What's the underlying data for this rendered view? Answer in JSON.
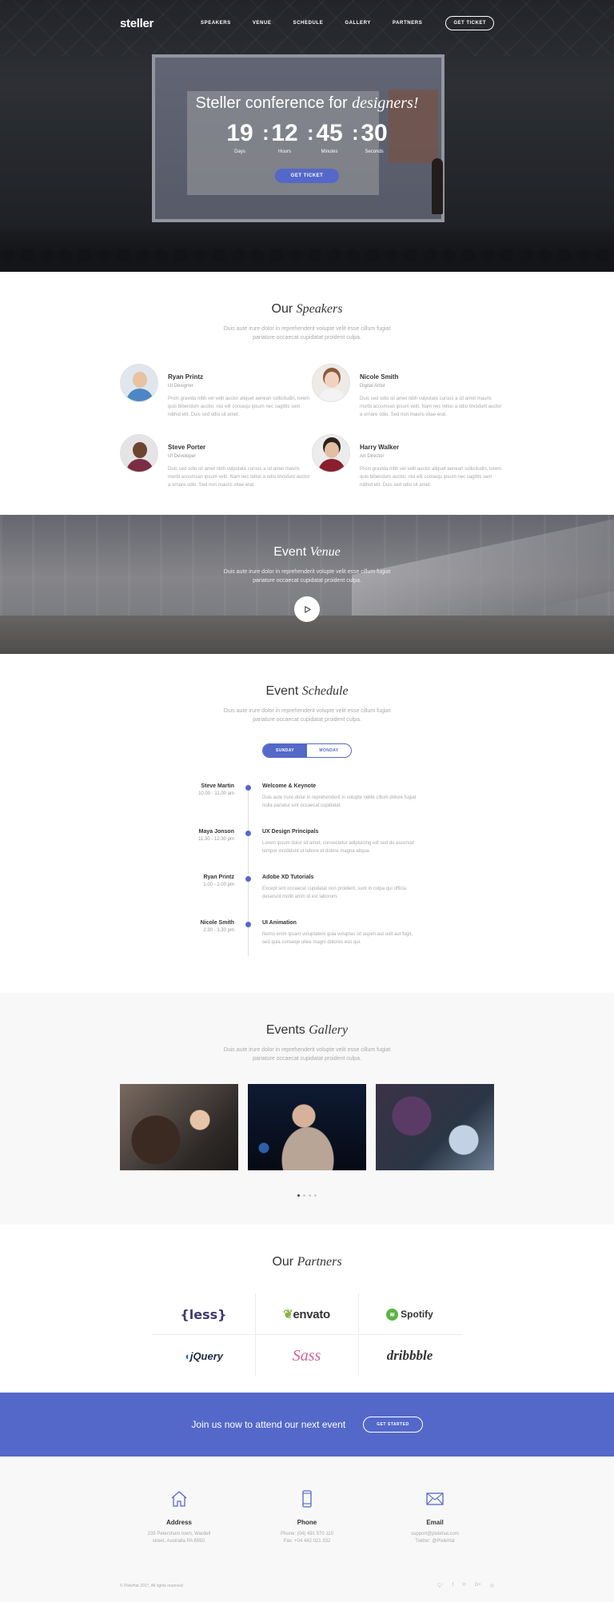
{
  "nav": {
    "logo": "steller",
    "links": [
      "SPEAKERS",
      "VENUE",
      "SCHEDULE",
      "GALLERY",
      "PARTNERS"
    ],
    "ticket": "GET TICKET"
  },
  "hero": {
    "title_plain": "Steller conference for ",
    "title_em": "designers!",
    "countdown": [
      {
        "value": "19",
        "label": "Days"
      },
      {
        "value": "12",
        "label": "Hours"
      },
      {
        "value": "45",
        "label": "Minutes"
      },
      {
        "value": "30",
        "label": "Seconds"
      }
    ],
    "button": "GET TICKET"
  },
  "speakers": {
    "title_plain": "Our ",
    "title_em": "Speakers",
    "desc1": "Duis aute irure dolor in reprehenderit volupte velit esse cillum fugiat",
    "desc2": "pariature occaecat cupidatat proident culpa.",
    "items": [
      {
        "name": "Ryan Printz",
        "role": "UI Designer",
        "bio": "Proin gravida nibh vel velit auctor aliquet aenean sollicitudin, lorem quis bibendum auctor, nisi elit consequ ipsum nec sagittis sem nibhid elit. Duis sed odio sit amet."
      },
      {
        "name": "Nicole Smith",
        "role": "Digital Artist",
        "bio": "Duis sed odio sit amet nibh vulputate cursus a sit amet mauris morbi accumsan ipsum velit. Nam nec tellus a odio tincidunt auctor a ornare odio. Sed non mauris vitae erat."
      },
      {
        "name": "Steve Porter",
        "role": "UI Developer",
        "bio": "Duis sed odio sit amet nibh vulputate cursus a sit amet mauris morbi accumsan ipsum velit. Nam nec tellus a odio tincidunt auctor a ornare odio. Sed non mauris vitae erat."
      },
      {
        "name": "Harry Walker",
        "role": "Art Director",
        "bio": "Proin gravida nibh vel velit auctor aliquet aenean sollicitudin, lorem quis bibendum auctor, nisi elit consequ ipsum nec sagittis sem nibhid elit. Duis sed odio sit amet."
      }
    ]
  },
  "venue": {
    "title_plain": "Event ",
    "title_em": "Venue",
    "desc1": "Duis aute irure dolor in reprehenderit volupte velit esse cillum fugiat",
    "desc2": "pariature occaecat cupidatat proident culpa."
  },
  "schedule": {
    "title_plain": "Event ",
    "title_em": "Schedule",
    "desc1": "Duis aute irure dolor in reprehenderit volupte velit esse cillum fugiat",
    "desc2": "pariature occaecat cupidatat proident culpa.",
    "tabs": [
      "SUNDAY",
      "MONDAY"
    ],
    "items": [
      {
        "who": "Steve Martin",
        "time": "10.00 - 11.00 am",
        "title": "Welcome & Keynote",
        "text": "Duis aute irure dolor in reprehenderit in volupte velite cillum dolore fugiat nulla pariatur sint occaecat cupidatat."
      },
      {
        "who": "Maya Jonson",
        "time": "11.30 - 12.30 pm",
        "title": "UX Design Principals",
        "text": "Lorem ipsum dolor sit amet, consectetur adipisicing elit sed do eiusmod tempor incididunt ut labore et dolore magna aliqua."
      },
      {
        "who": "Ryan Printz",
        "time": "1.00 - 2.00 pm",
        "title": "Adobe XD Tutorials",
        "text": "Except sint occaecat cupidatat non proident, sunt in culpa qui officia deserunt mollit anim id est laborum."
      },
      {
        "who": "Nicole Smith",
        "time": "2.30 - 3.30 pm",
        "title": "UI Animation",
        "text": "Nemo enim ipsam voluptatem quia voluptas sit aspen aut odit aut fugit, sed quia conseqe uitee magni dolores eos qui."
      }
    ]
  },
  "gallery": {
    "title_plain": "Events ",
    "title_em": "Gallery",
    "desc1": "Duis aute irure dolor in reprehenderit volupte velit esse cillum fugiat",
    "desc2": "pariature occaecat cupidatat proident culpa."
  },
  "partners": {
    "title_plain": "Our ",
    "title_em": "Partners",
    "logos": [
      "{less}",
      "envato",
      "Spotify",
      "jQuery",
      "Sass",
      "dribbble"
    ]
  },
  "cta": {
    "text": "Join us now to attend our next event",
    "button": "GET STARTED"
  },
  "footer": {
    "address_title": "Address",
    "address_line1": "235 Petersham town, Wardell",
    "address_line2": "street, Australia PA 6550.",
    "phone_title": "Phone",
    "phone_line1": "Phone: (04) 491 570 110",
    "phone_line2": "Fax: +04 442 021 332",
    "email_title": "Email",
    "email_line1": "support@pixlehat.com",
    "email_line2": "Twitter: @PixleHat",
    "copyright": "© PixleHat 2017, All rights reserved",
    "social": [
      "twitter-icon",
      "facebook-icon",
      "pinterest-icon",
      "google-plus-icon",
      "instagram-icon"
    ],
    "accent": "#5468c9"
  }
}
